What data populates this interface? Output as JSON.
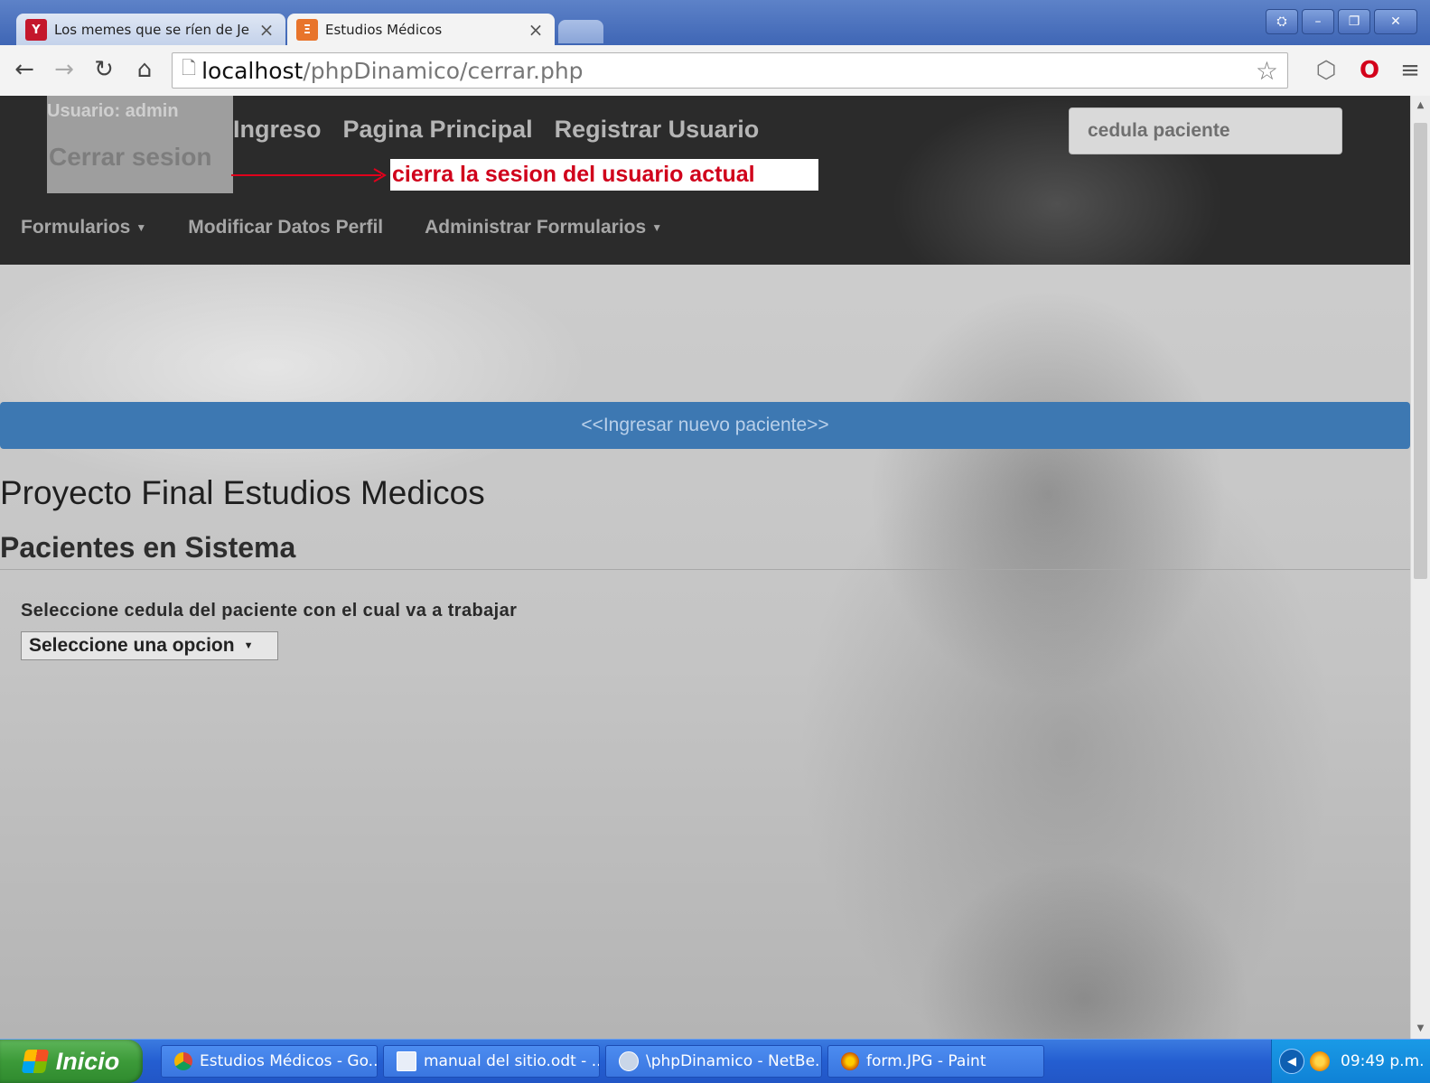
{
  "browser": {
    "tabs": [
      {
        "title": "Los memes que se ríen de Je",
        "favicon": "Y",
        "favicon_color": "#c4172c",
        "active": false
      },
      {
        "title": "Estudios Médicos",
        "favicon": "Ξ",
        "favicon_color": "#e8742b",
        "active": true
      }
    ],
    "url_host": "localhost",
    "url_path": "/phpDinamico/cerrar.php",
    "icons": {
      "back": "arrow-left-icon",
      "forward": "arrow-right-icon",
      "reload": "reload-icon",
      "home": "home-icon",
      "bookmark": "star-icon"
    }
  },
  "site": {
    "user_label": "Usuario: admin",
    "logout_label": "Cerrar sesion",
    "nav": [
      "Ingreso",
      "Pagina Principal",
      "Registrar Usuario"
    ],
    "search_placeholder": "cedula paciente",
    "annotation": "cierra la sesion del usuario actual",
    "subnav": [
      "Formularios",
      "Modificar Datos Perfil",
      "Administrar Formularios"
    ],
    "new_patient": "<<Ingresar nuevo paciente>>",
    "title": "Proyecto Final Estudios Medicos",
    "subtitle": "Pacientes en Sistema",
    "select_label": "Seleccione cedula del paciente con el cual va a trabajar",
    "select_value": "Seleccione una opcion",
    "colors": {
      "header": "#2b2b2b",
      "primary_bar": "#3d78b2",
      "annotation_text": "#d0001b"
    }
  },
  "taskbar": {
    "start_label": "Inicio",
    "tasks": [
      {
        "label": "Estudios Médicos - Go...",
        "icon": "chrome-icon"
      },
      {
        "label": "manual del sitio.odt - ...",
        "icon": "document-icon"
      },
      {
        "label": "\\phpDinamico - NetBe...",
        "icon": "netbeans-icon"
      },
      {
        "label": "form.JPG - Paint",
        "icon": "paint-icon"
      }
    ],
    "clock": "09:49 p.m."
  }
}
